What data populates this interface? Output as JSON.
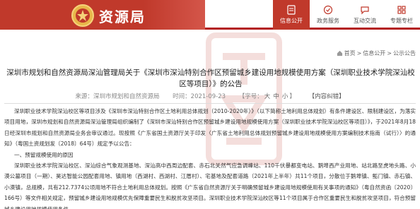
{
  "header": {
    "site_name": "资源局",
    "nav": [
      {
        "label": "信息公开",
        "icon": "document-icon",
        "active": true
      },
      {
        "label": "政务服务",
        "icon": "service-icon",
        "active": false
      },
      {
        "label": "互动交流",
        "icon": "chat-icon",
        "active": false
      },
      {
        "label": "专题专栏",
        "icon": "topic-icon",
        "active": false
      }
    ],
    "accent_color": "#c0392b"
  },
  "breadcrumb": {
    "items": [
      "首页",
      "信息公开",
      "公示公告"
    ],
    "separator": " > "
  },
  "article": {
    "title": "深圳市规划和自然资源局深汕管理局关于《深圳市深汕特别合作区预留城乡建设用地规模使用方案（深圳职业技术学院深汕校区等项目）》的公告",
    "source_label": "来源：",
    "source": "深圳市规划和自然资源局",
    "time_label": "时间：",
    "time": "2021-09-23",
    "font_label": "【字号：",
    "font_options": [
      "大",
      "中",
      "小"
    ],
    "font_close": "】",
    "error_report": "【内容纠错】",
    "paragraphs": [
      "深圳职业技术学院深汕校区等项目涉及《深圳市深汕特别合作区土地利用总体规划（2010-2020年）》（以下简称土地利用总体规划）有条件建设区、限制建设区，为落实项目用地，深圳市规划和自然资源局深汕管理局组织编制了《深圳市深汕特别合作区预留城乡建设用地规模使用方案（深圳职业技术学院深汕校区等项目）》，于2021年8月18日经深圳市规划和自然资源局业务会审议通过。现按照《广东省国土资源厅关于印发〈广东省土地利用总体规划预留城乡建设用地规模使用方案编制技术指南（试行）〉的通知》（粤国土资规划发〔2018〕64号）规定予以公告：",
      "一、预留规模使用的原因",
      "深圳职业技术学院深汕校区、深汕综合气象观测基地、深汕高中西周边配套、赤石北关然气应急调峰站、110千伏暴都变电站、鹅埠西产业用地、站北路至虎地头路、小漠公墓项目（一期）、昊达智能公园配套用地、镇用地（西湖村、西湖村、江厝村）、宅基地及配套道路（2021年上半年）共11个项目，分散位于鹅埠镇、鲘门镇、赤石镇、小漠镇，总规模，共有212.7374公顷用地不符合土地利用总体规划。按照《广东省自然资源厅关于明确预留城乡建设用地规模使用有关事项的通知》（粤自然资函〔2020〕166号）等文件相关规定，预留城乡建设用地规模优先保障重要民生和脱贫攻坚项目。深圳职业技术学院深汕校区等11个项目属于合作区重要民生和脱贫攻坚项目，符合预留城乡建设用地规模使用条件。"
    ]
  },
  "watermark_text": "资源局"
}
